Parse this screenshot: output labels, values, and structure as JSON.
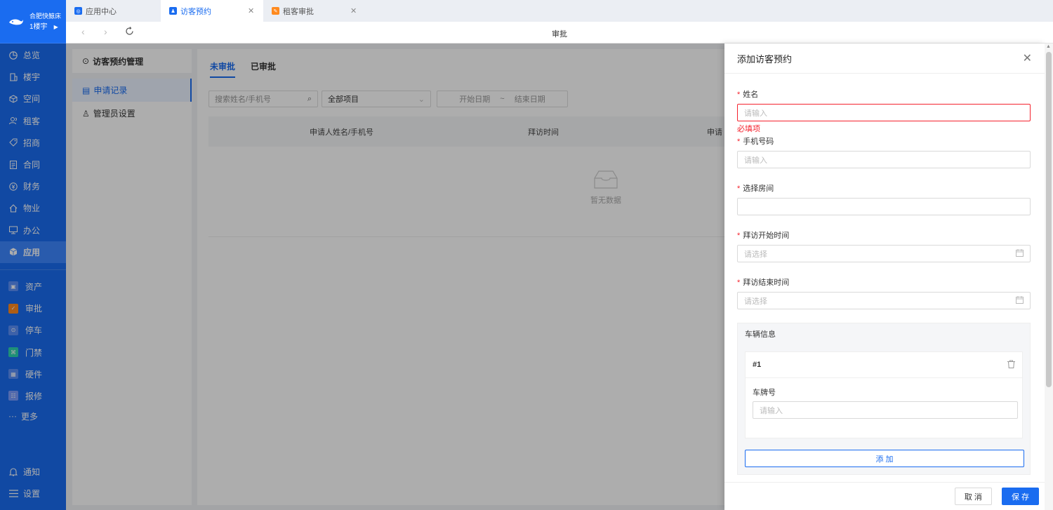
{
  "brand": {
    "name": "合肥快鲸床",
    "site": "1楼宇"
  },
  "nav": {
    "main": [
      {
        "label": "总览",
        "icon": "dashboard-icon"
      },
      {
        "label": "楼宇",
        "icon": "building-icon"
      },
      {
        "label": "空间",
        "icon": "cube-icon"
      },
      {
        "label": "租客",
        "icon": "users-icon"
      },
      {
        "label": "招商",
        "icon": "tag-icon"
      },
      {
        "label": "合同",
        "icon": "contract-icon"
      },
      {
        "label": "财务",
        "icon": "finance-icon"
      },
      {
        "label": "物业",
        "icon": "home-icon"
      },
      {
        "label": "办公",
        "icon": "monitor-icon"
      },
      {
        "label": "应用",
        "icon": "app-cube-icon",
        "active": true
      }
    ],
    "apps": [
      {
        "label": "资产",
        "color": "#5b8ff9"
      },
      {
        "label": "审批",
        "color": "#ff8a1f"
      },
      {
        "label": "停车",
        "color": "#5b8ff9"
      },
      {
        "label": "门禁",
        "color": "#2dd4b0"
      },
      {
        "label": "硬件",
        "color": "#5b8ff9"
      },
      {
        "label": "报修",
        "color": "#7b9cff"
      }
    ],
    "more": "更多",
    "notify": "通知",
    "settings": "设置"
  },
  "tabs": [
    {
      "label": "应用中心",
      "color": "#1a6cf0"
    },
    {
      "label": "访客预约",
      "color": "#1a6cf0",
      "active": true
    },
    {
      "label": "租客审批",
      "color": "#ff8a1f"
    }
  ],
  "toolbar": {
    "title": "审批"
  },
  "leftPanel": {
    "title": "访客预约管理",
    "items": [
      "申请记录",
      "管理员设置"
    ]
  },
  "main": {
    "subtabs": [
      "未审批",
      "已审批"
    ],
    "search_placeholder": "搜索姓名/手机号",
    "project": "全部项目",
    "start_date": "开始日期",
    "range_sep": "~",
    "end_date": "结束日期",
    "columns": [
      "申请人姓名/手机号",
      "拜访时间",
      "申请"
    ],
    "empty": "暂无数据"
  },
  "drawer": {
    "title": "添加访客预约",
    "name_label": "姓名",
    "name_placeholder": "请输入",
    "name_error": "必填项",
    "phone_label": "手机号码",
    "phone_placeholder": "请输入",
    "room_label": "选择房间",
    "start_label": "拜访开始时间",
    "start_placeholder": "请选择",
    "end_label": "拜访结束时间",
    "end_placeholder": "请选择",
    "vehicle_title": "车辆信息",
    "vehicle_index": "#1",
    "plate_label": "车牌号",
    "plate_placeholder": "请输入",
    "add_label": "添 加",
    "cancel_label": "取 消",
    "save_label": "保 存"
  }
}
